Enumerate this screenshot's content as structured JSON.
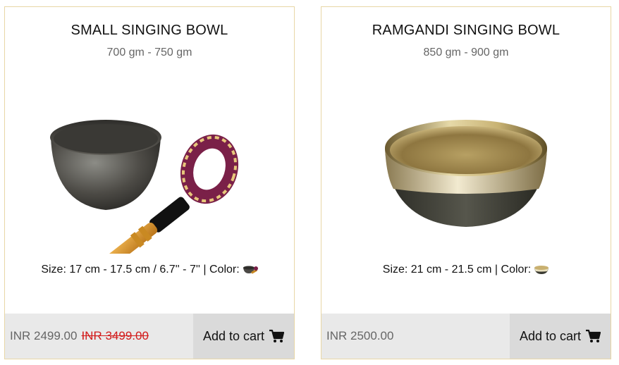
{
  "products": [
    {
      "title": "SMALL SINGING BOWL",
      "weight": "700 gm - 750 gm",
      "size_text": "Size: 17 cm - 17.5 cm / 6.7'' - 7'' | Color:",
      "price": "INR 2499.00",
      "old_price": "INR 3499.00",
      "cart_label": "Add to cart",
      "image": "singing-bowl-with-cushion-and-mallet",
      "color_swatch": "bowl-with-mallet-thumbnail"
    },
    {
      "title": "RAMGANDI SINGING BOWL",
      "weight": "850 gm - 900 gm",
      "size_text": "Size: 21 cm - 21.5 cm | Color:",
      "price": "INR 2500.00",
      "cart_label": "Add to cart",
      "image": "golden-singing-bowl",
      "color_swatch": "golden-bowl-thumbnail"
    }
  ],
  "colors": {
    "card_border": "#e8d7a6",
    "footer_bg": "#e9e9e9",
    "cart_bg": "#dadada",
    "sale_red": "#d21a1a"
  },
  "icons": {
    "cart": "shopping-cart-icon"
  }
}
